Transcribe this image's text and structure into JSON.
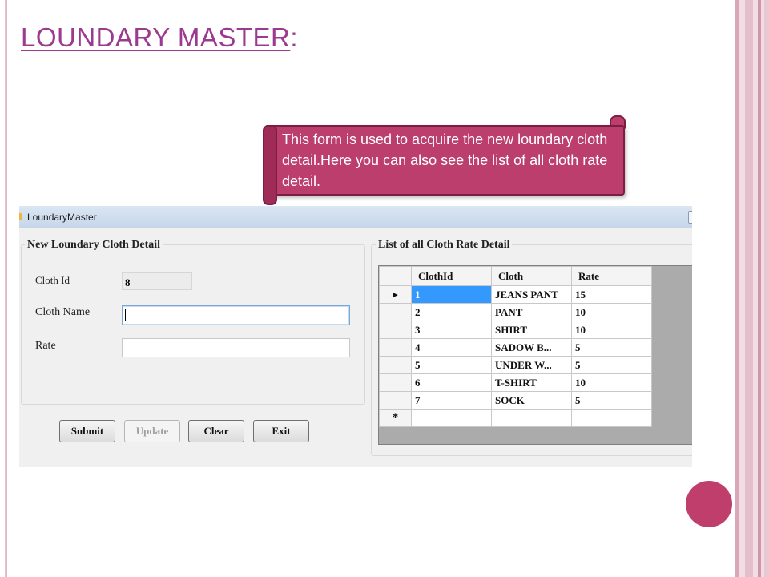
{
  "slide": {
    "title": "LOUNDARY MASTER",
    "title_suffix": ":",
    "callout": "This form is used to acquire the new loundary cloth detail.Here you can also see the list of all cloth  rate detail.",
    "colors": {
      "accent": "#bf3e6b",
      "title": "#9b3a8f"
    }
  },
  "window": {
    "title": "LoundaryMaster",
    "form": {
      "group_title": "New Loundary Cloth Detail",
      "cloth_id_label": "Cloth Id",
      "cloth_id_value": "8",
      "cloth_name_label": "Cloth Name",
      "cloth_name_value": "",
      "rate_label": "Rate",
      "rate_value": ""
    },
    "buttons": {
      "submit": "Submit",
      "update": "Update",
      "clear": "Clear",
      "exit": "Exit"
    },
    "list": {
      "group_title": "List of all Cloth Rate Detail",
      "columns": [
        "ClothId",
        "Cloth",
        "Rate"
      ],
      "rows": [
        [
          "1",
          "JEANS PANT",
          "15"
        ],
        [
          "2",
          "PANT",
          "10"
        ],
        [
          "3",
          "SHIRT",
          "10"
        ],
        [
          "4",
          "SADOW B...",
          "5"
        ],
        [
          "5",
          "UNDER W...",
          "5"
        ],
        [
          "6",
          "T-SHIRT",
          "10"
        ],
        [
          "7",
          "SOCK",
          "5"
        ]
      ],
      "current_row_marker": "▸",
      "new_row_marker": "*"
    }
  }
}
